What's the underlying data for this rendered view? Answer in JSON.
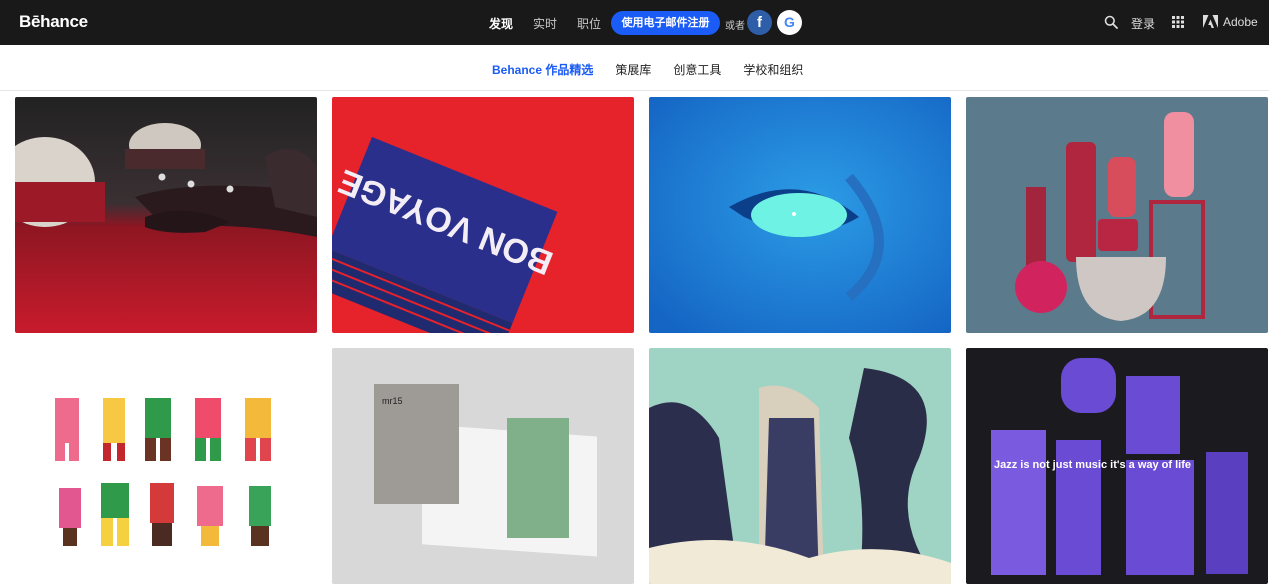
{
  "header": {
    "logo": "Bēhance",
    "nav": [
      {
        "label": "发现",
        "active": true
      },
      {
        "label": "实时",
        "active": false
      },
      {
        "label": "职位",
        "active": false
      }
    ],
    "signup_label": "使用电子邮件注册",
    "or_label": "或者",
    "facebook_glyph": "f",
    "google_glyph": "G",
    "login_label": "登录",
    "adobe_label": "Adobe",
    "icons": [
      "search-icon",
      "apps-grid-icon",
      "adobe-logo-icon",
      "facebook-icon",
      "google-icon"
    ]
  },
  "subnav": {
    "items": [
      {
        "label": "Behance 作品精选",
        "active": true
      },
      {
        "label": "策展库",
        "active": false
      },
      {
        "label": "创意工具",
        "active": false
      },
      {
        "label": "学校和组织",
        "active": false
      }
    ]
  },
  "gallery": {
    "cards": [
      {
        "subject": "red sea landscape with domes and astronauts"
      },
      {
        "subject": "Bon Voyage book on red background",
        "text": "BON VOYAGE"
      },
      {
        "subject": "blue face close-up with glowing eye"
      },
      {
        "subject": "pink cosmetic bottles on pedestals"
      },
      {
        "subject": "illustrated colorful characters"
      },
      {
        "subject": "mr15 print brochure mockup",
        "text": "mr15"
      },
      {
        "subject": "japanese style geisha and dragon illustration"
      },
      {
        "subject": "purple jazz festival packaging",
        "text": "Jazz is not just music it's a way of life"
      }
    ]
  },
  "colors": {
    "topbar": "#191919",
    "accent_blue": "#1a5cf5"
  }
}
